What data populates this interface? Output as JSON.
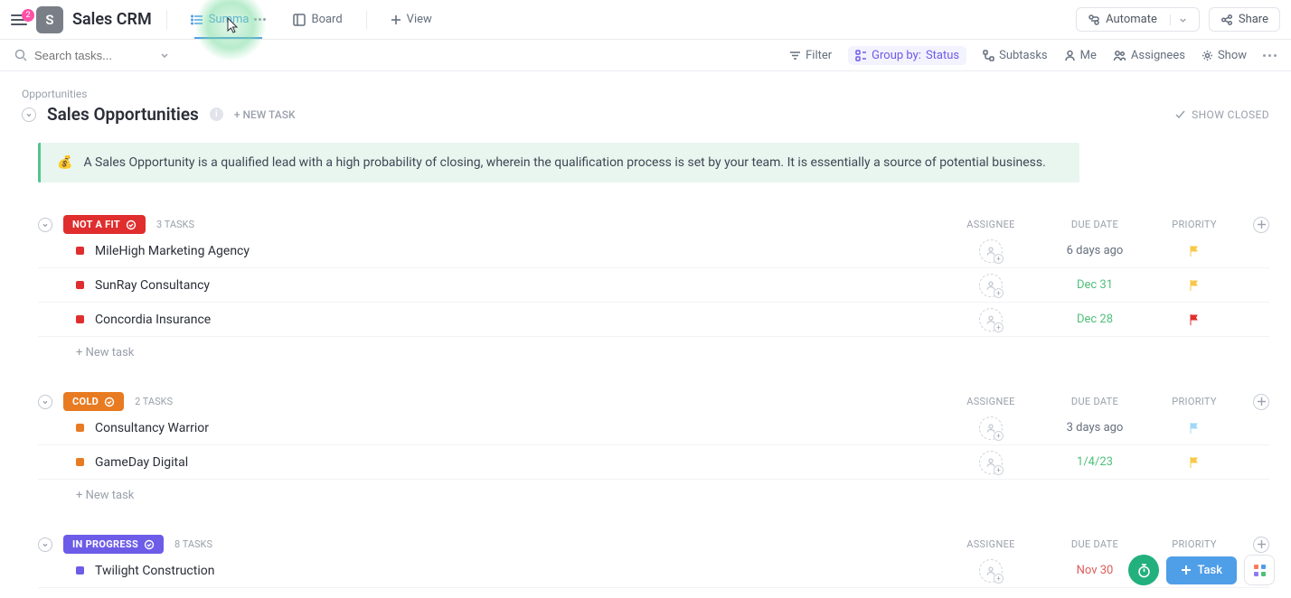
{
  "header": {
    "notif_badge": "2",
    "workspace_letter": "S",
    "title": "Sales CRM",
    "views": [
      {
        "label": "Summa",
        "icon": "list-icon",
        "active": true,
        "has_more": true
      },
      {
        "label": "Board",
        "icon": "board-icon",
        "active": false
      }
    ],
    "add_view_label": "View",
    "automate_label": "Automate",
    "share_label": "Share"
  },
  "filters": {
    "search_placeholder": "Search tasks...",
    "filter_label": "Filter",
    "group_prefix": "Group by:",
    "group_value": "Status",
    "subtasks_label": "Subtasks",
    "me_label": "Me",
    "assignees_label": "Assignees",
    "show_label": "Show"
  },
  "list": {
    "breadcrumb": "Opportunities",
    "title": "Sales Opportunities",
    "new_task_label": "+ NEW TASK",
    "show_closed_label": "SHOW CLOSED",
    "description_emoji": "💰",
    "description": "A Sales Opportunity is a qualified lead with a high probability of closing, wherein the qualification process is set by your team. It is essentially a source of potential business."
  },
  "columns": {
    "assignee": "ASSIGNEE",
    "due": "DUE DATE",
    "priority": "PRIORITY"
  },
  "groups": [
    {
      "name": "NOT A FIT",
      "color": "#e02e2e",
      "count": "3 TASKS",
      "tasks": [
        {
          "name": "MileHigh Marketing Agency",
          "due": "6 days ago",
          "due_class": "grey",
          "flag": "#f7c948"
        },
        {
          "name": "SunRay Consultancy",
          "due": "Dec 31",
          "due_class": "green",
          "flag": "#f7c948"
        },
        {
          "name": "Concordia Insurance",
          "due": "Dec 28",
          "due_class": "green",
          "flag": "#e02e2e"
        }
      ],
      "newtask": "+ New task"
    },
    {
      "name": "COLD",
      "color": "#e87b22",
      "count": "2 TASKS",
      "tasks": [
        {
          "name": "Consultancy Warrior",
          "due": "3 days ago",
          "due_class": "grey",
          "flag": "#9fd9f6"
        },
        {
          "name": "GameDay Digital",
          "due": "1/4/23",
          "due_class": "green",
          "flag": "#f7c948"
        }
      ],
      "newtask": "+ New task"
    },
    {
      "name": "IN PROGRESS",
      "color": "#6c5ce7",
      "count": "8 TASKS",
      "tasks": [
        {
          "name": "Twilight Construction",
          "due": "Nov 30",
          "due_class": "red",
          "flag": "#e02e2e"
        }
      ]
    }
  ],
  "floaters": {
    "task_label": "Task"
  }
}
